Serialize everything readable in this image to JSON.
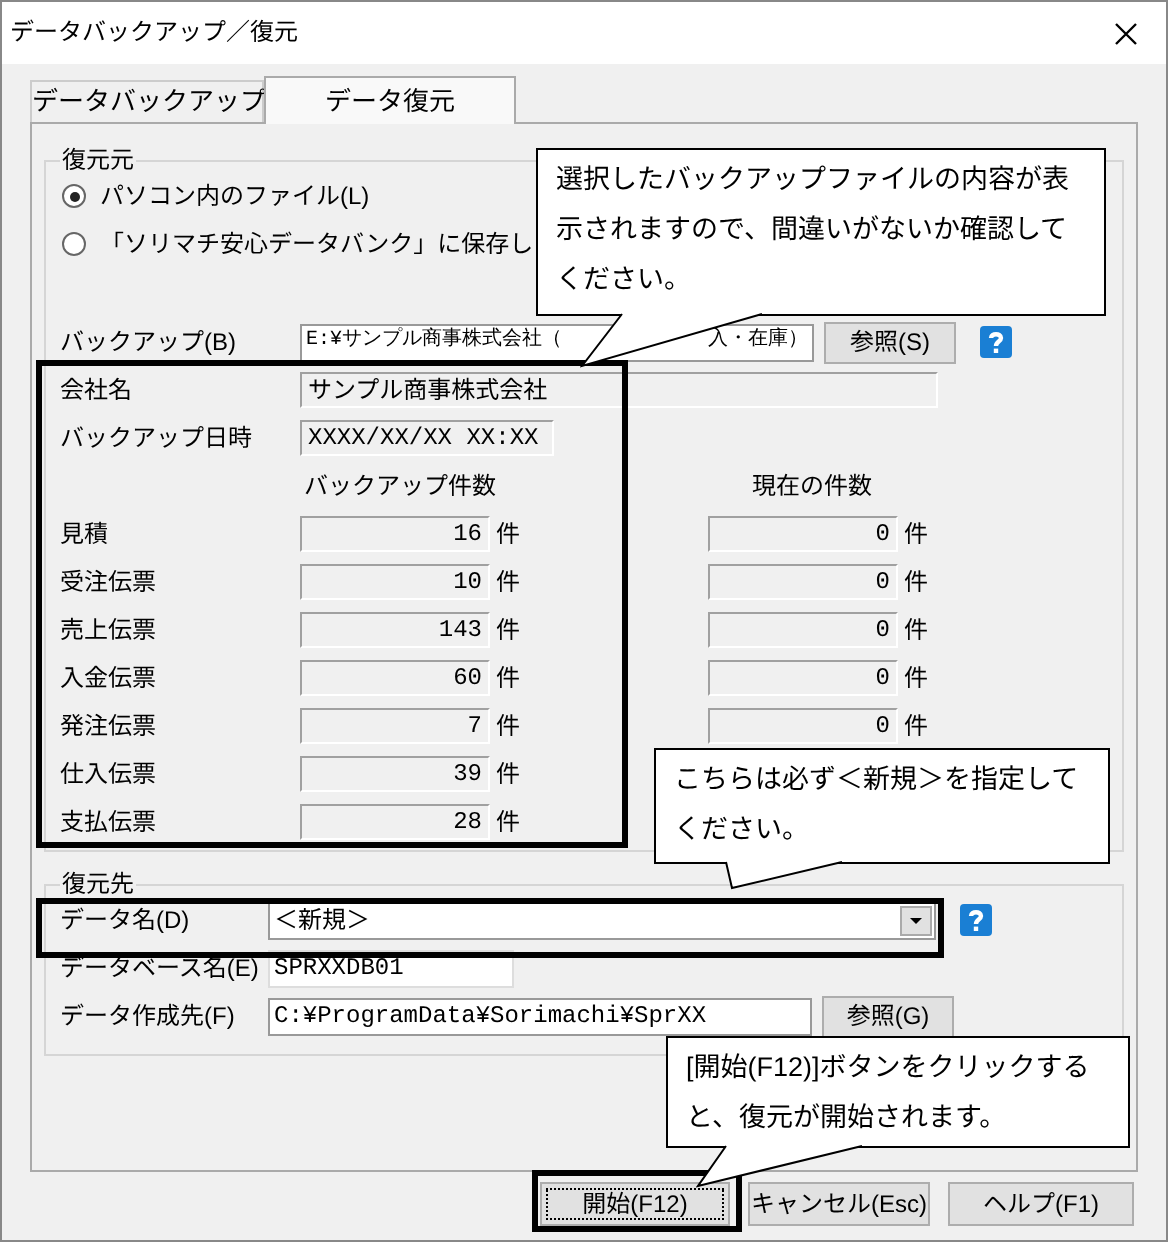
{
  "window": {
    "title": "データバックアップ／復元"
  },
  "tabs": [
    {
      "label": "データバックアップ",
      "selected": false
    },
    {
      "label": "データ復元",
      "selected": true
    }
  ],
  "source": {
    "title": "復元元",
    "options": [
      {
        "label": "パソコン内のファイル(L)",
        "selected": true
      },
      {
        "label": "「ソリマチ安心データバンク」に保存し",
        "selected": false
      }
    ],
    "backup": {
      "label": "バックアップ(B)",
      "value_start": "E:¥サンプル商事株式会社（",
      "value_end": "入・在庫）",
      "button": "参照(S)"
    },
    "company": {
      "label": "会社名",
      "value": "サンプル商事株式会社"
    },
    "date": {
      "label": "バックアップ日時",
      "value": "XXXX/XX/XX XX:XX"
    },
    "columns": [
      "バックアップ件数",
      "現在の件数"
    ],
    "counts": [
      {
        "label": "見積",
        "backup": "16",
        "backup_unit": "件",
        "current": "0",
        "current_unit": "件"
      },
      {
        "label": "受注伝票",
        "backup": "10",
        "backup_unit": "件",
        "current": "0",
        "current_unit": "件"
      },
      {
        "label": "売上伝票",
        "backup": "143",
        "backup_unit": "件",
        "current": "0",
        "current_unit": "件"
      },
      {
        "label": "入金伝票",
        "backup": "60",
        "backup_unit": "件",
        "current": "0",
        "current_unit": "件"
      },
      {
        "label": "発注伝票",
        "backup": "7",
        "backup_unit": "件",
        "current": "0",
        "current_unit": "件"
      },
      {
        "label": "仕入伝票",
        "backup": "39",
        "backup_unit": "件"
      },
      {
        "label": "支払伝票",
        "backup": "28",
        "backup_unit": "件"
      }
    ]
  },
  "destination": {
    "title": "復元先",
    "data_name": {
      "label": "データ名(D)",
      "value": "＜新規＞"
    },
    "db_name": {
      "label": "データベース名(E)",
      "value": "SPRXXDB01"
    },
    "location": {
      "label": "データ作成先(F)",
      "value": "C:¥ProgramData¥Sorimachi¥SprXX",
      "button": "参照(G)"
    }
  },
  "buttons": [
    {
      "label": "開始(F12)",
      "focused": true
    },
    {
      "label": "キャンセル(Esc)",
      "focused": false
    },
    {
      "label": "ヘルプ(F1)",
      "focused": false
    }
  ],
  "callouts": [
    {
      "text": "選択したバックアップファイルの内容が表示されますので、間違いがないか確認してください。"
    },
    {
      "text": "こちらは必ず＜新規＞を指定してください。"
    },
    {
      "text": "[開始(F12)]ボタンをクリックすると、復元が開始されます。"
    }
  ]
}
